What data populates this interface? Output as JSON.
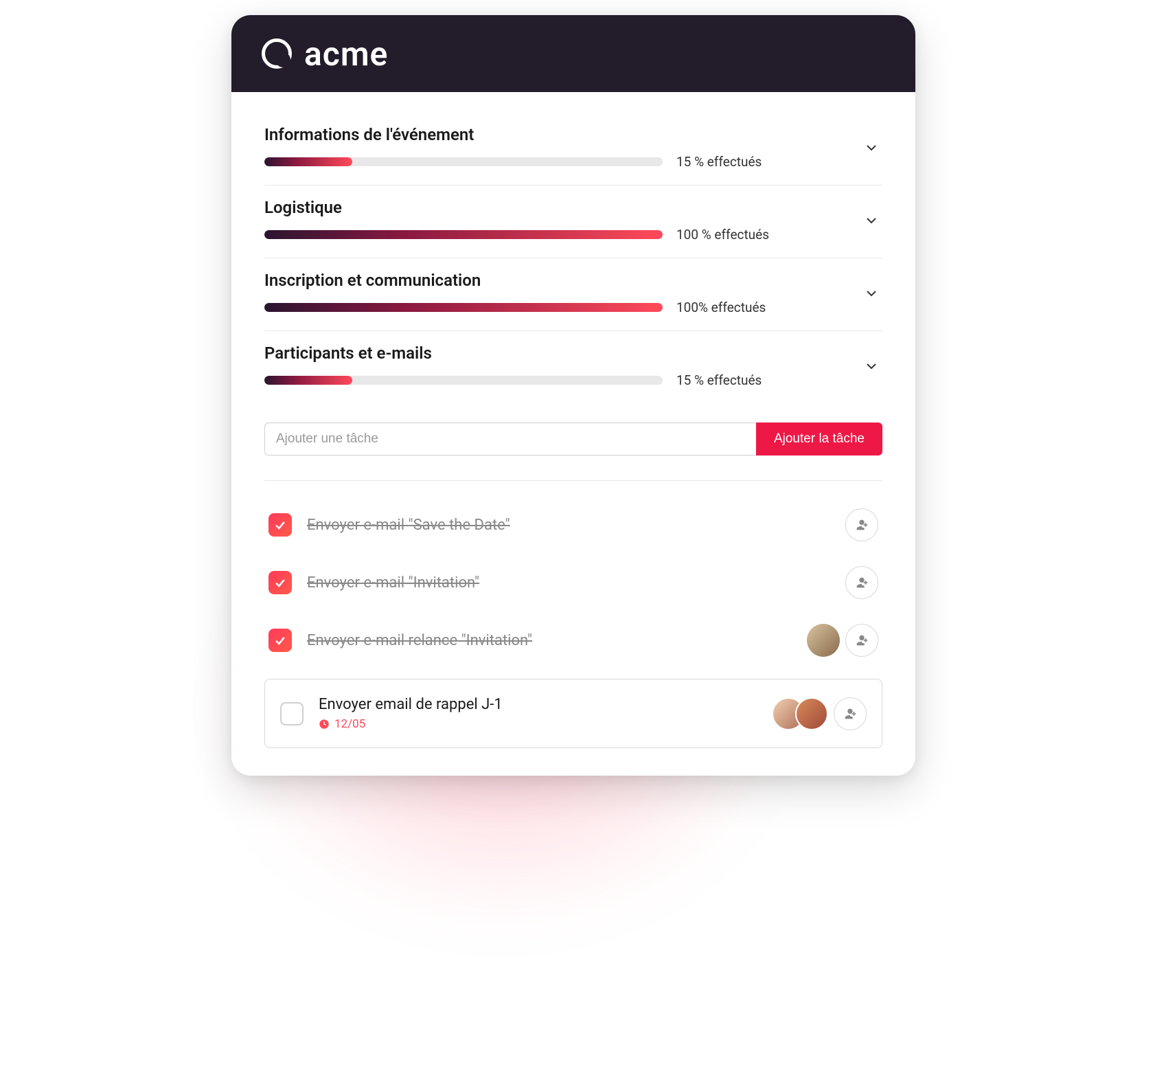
{
  "brand": {
    "name": "acme"
  },
  "sections": [
    {
      "title": "Informations de l'événement",
      "percent": 15,
      "status": "15 % effectués"
    },
    {
      "title": "Logistique",
      "percent": 100,
      "status": "100 % effectués"
    },
    {
      "title": "Inscription et communication",
      "percent": 100,
      "status": "100% effectués"
    },
    {
      "title": "Participants et e-mails",
      "percent": 15,
      "status": "15 % effectués"
    }
  ],
  "add_task": {
    "placeholder": "Ajouter une tâche",
    "button": "Ajouter la tâche"
  },
  "tasks": [
    {
      "label": "Envoyer e-mail \"Save the Date\"",
      "done": true,
      "date": null,
      "assignees": 0
    },
    {
      "label": "Envoyer e-mail \"Invitation\"",
      "done": true,
      "date": null,
      "assignees": 0
    },
    {
      "label": "Envoyer e-mail relance \"Invitation\"",
      "done": true,
      "date": null,
      "assignees": 1
    },
    {
      "label": "Envoyer email de rappel J-1",
      "done": false,
      "date": "12/05",
      "assignees": 2
    }
  ],
  "colors": {
    "accent": "#ED1846",
    "header_bg": "#231C2B"
  }
}
